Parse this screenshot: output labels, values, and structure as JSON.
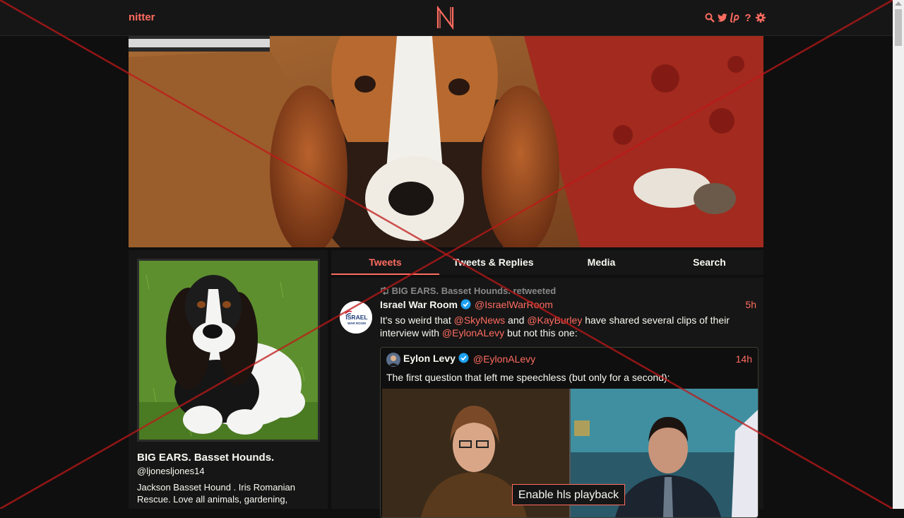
{
  "navbar": {
    "brand": "nitter",
    "icons": [
      "search-icon",
      "twitter-icon",
      "liberapay-icon",
      "help-icon",
      "settings-icon"
    ],
    "help_glyph": "?"
  },
  "profile": {
    "fullname": "BIG EARS. Basset Hounds.",
    "username": "@ljonesljones14",
    "bio": "Jackson Basset Hound . Iris Romanian Rescue. Love all animals, gardening,"
  },
  "tabs": [
    {
      "label": "Tweets",
      "active": true
    },
    {
      "label": "Tweets & Replies",
      "active": false
    },
    {
      "label": "Media",
      "active": false
    },
    {
      "label": "Search",
      "active": false
    }
  ],
  "tweet": {
    "retweet_header": "BIG EARS. Basset Hounds. retweeted",
    "fullname": "Israel War Room",
    "username": "@IsraelWarRoom",
    "time": "5h",
    "text_parts": {
      "p1": "It's so weird that ",
      "m1": "@SkyNews",
      "p2": " and ",
      "m2": "@KayBurley",
      "p3": " have shared several clips of their interview with ",
      "m3": "@EylonALevy",
      "p4": " but not this one:"
    },
    "avatar_text": {
      "line1": "ISRAEL",
      "line2": "WAR ROOM"
    },
    "quote": {
      "fullname": "Eylon Levy",
      "username": "@EylonALevy",
      "time": "14h",
      "text": "The first question that left me speechless (but only for a second):"
    }
  },
  "video": {
    "button": "Enable hls playback"
  },
  "colors": {
    "accent": "#ff6c60",
    "background": "#0f0f0f",
    "panel": "#161616",
    "text": "#f8f8f2",
    "muted": "#888889"
  }
}
